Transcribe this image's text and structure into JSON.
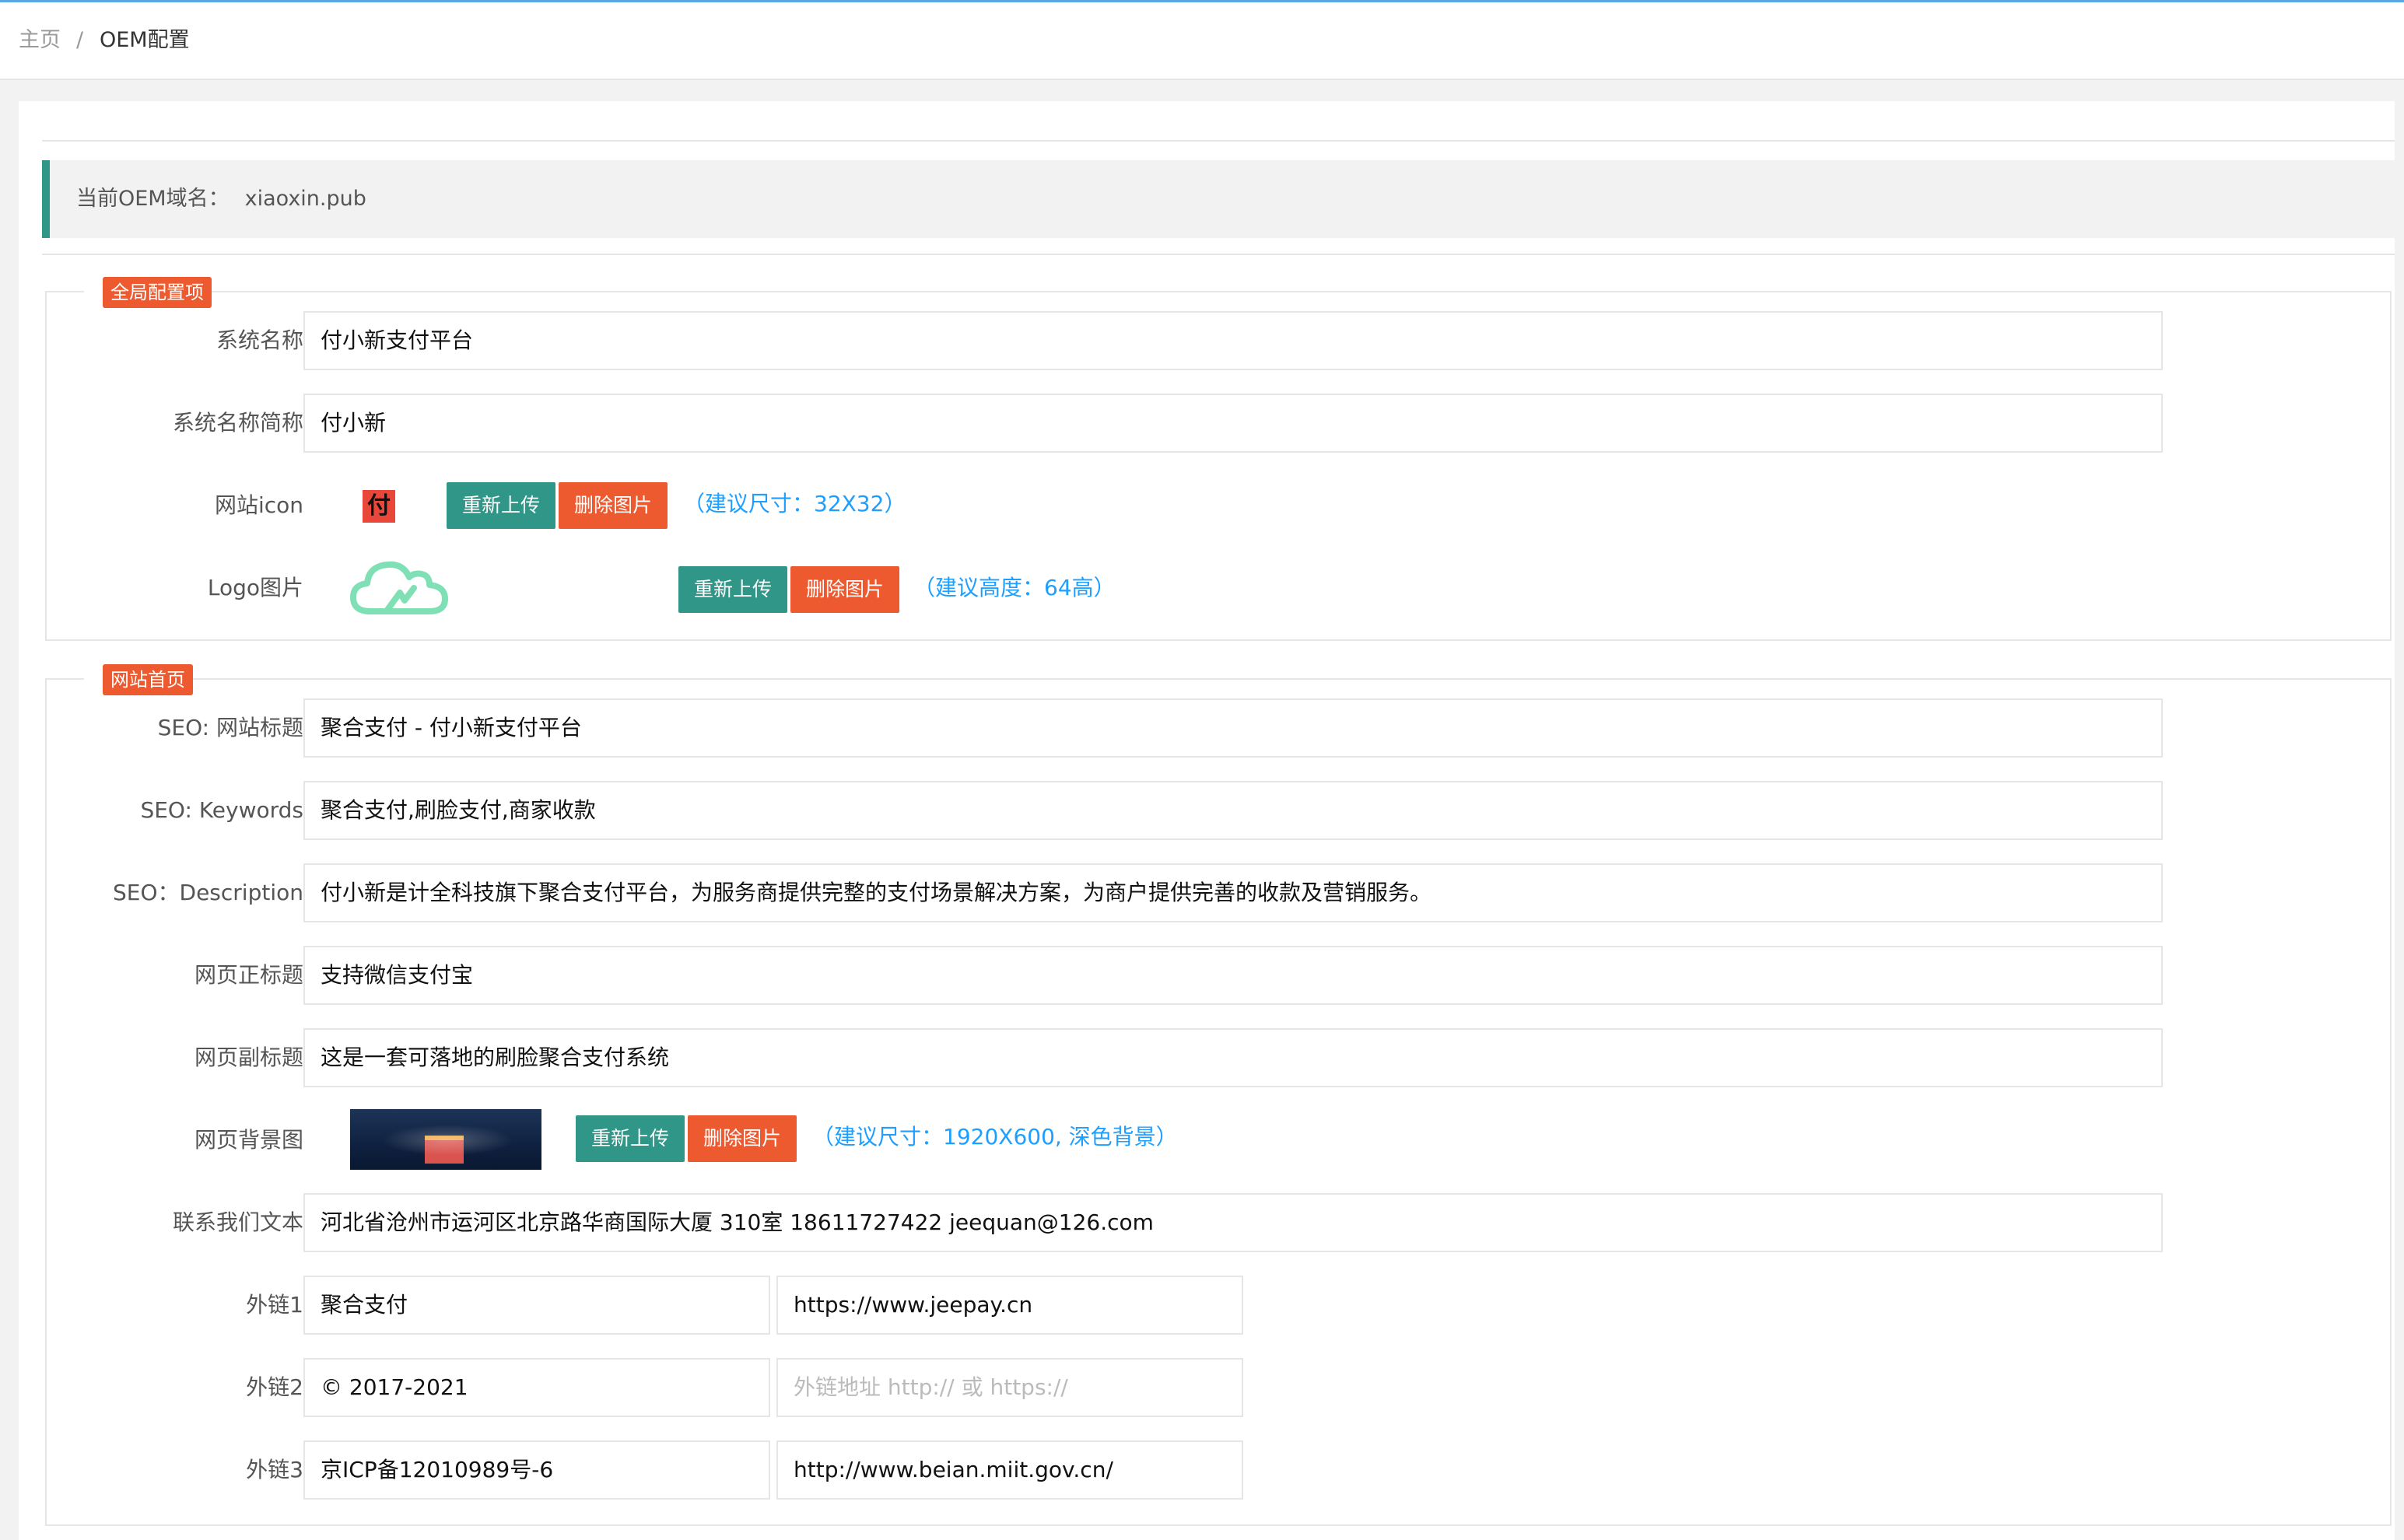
{
  "breadcrumb": {
    "home": "主页",
    "separator": "/",
    "current": "OEM配置"
  },
  "domain": {
    "label": "当前OEM域名：",
    "value": "xiaoxin.pub"
  },
  "colors": {
    "accent_teal": "#2f9688",
    "accent_red": "#ee5a2f",
    "hint_blue": "#1e9fff"
  },
  "global": {
    "legend": "全局配置项",
    "system_name": {
      "label": "系统名称",
      "value": "付小新支付平台"
    },
    "system_short": {
      "label": "系统名称简称",
      "value": "付小新"
    },
    "icon": {
      "label": "网站icon",
      "icon_text": "付",
      "reupload": "重新上传",
      "delete": "删除图片",
      "hint": "（建议尺寸：32X32）"
    },
    "logo": {
      "label": "Logo图片",
      "reupload": "重新上传",
      "delete": "删除图片",
      "hint": "（建议高度：64高）"
    }
  },
  "home": {
    "legend": "网站首页",
    "seo_title": {
      "label": "SEO: 网站标题",
      "value": "聚合支付 - 付小新支付平台"
    },
    "seo_keywords": {
      "label": "SEO: Keywords",
      "value": "聚合支付,刷脸支付,商家收款"
    },
    "seo_desc": {
      "label": "SEO：Description",
      "value": "付小新是计全科技旗下聚合支付平台，为服务商提供完整的支付场景解决方案，为商户提供完善的收款及营销服务。"
    },
    "page_title": {
      "label": "网页正标题",
      "value": "支持微信支付宝"
    },
    "page_subtitle": {
      "label": "网页副标题",
      "value": "这是一套可落地的刷脸聚合支付系统"
    },
    "bg_image": {
      "label": "网页背景图",
      "reupload": "重新上传",
      "delete": "删除图片",
      "hint": "（建议尺寸：1920X600, 深色背景）"
    },
    "contact": {
      "label": "联系我们文本",
      "value": "河北省沧州市运河区北京路华商国际大厦 310室 18611727422 jeequan@126.com"
    },
    "links": [
      {
        "label": "外链1",
        "name": "聚合支付",
        "url": "https://www.jeepay.cn",
        "url_placeholder": ""
      },
      {
        "label": "外链2",
        "name": "© 2017-2021",
        "url": "",
        "url_placeholder": "外链地址 http:// 或 https://"
      },
      {
        "label": "外链3",
        "name": "京ICP备12010989号-6",
        "url": "http://www.beian.miit.gov.cn/",
        "url_placeholder": ""
      }
    ]
  }
}
